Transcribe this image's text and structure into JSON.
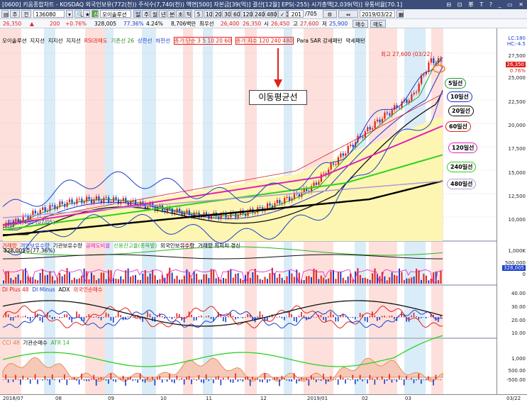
{
  "title": "[0600] 키움종합차트 - KOSDAQ 외국인보유(772(천)) 주식수(7,740(천)) 액면[500] 자본금[39(억)] 결산[12월] EPS(-255) 시가총액[2,039(억)] 유통비율[70.1]",
  "window_controls": "⊟ ⊡ 革 T ? _ ▭ ✕",
  "toolbar1": {
    "code": "136080",
    "name": "오이솔루션",
    "period_buttons": [
      "일",
      "주",
      "월",
      "년",
      "분",
      "초",
      "틱"
    ],
    "minute_buttons": [
      "5",
      "10",
      "20",
      "30",
      "60",
      "120",
      "240",
      "480",
      "120"
    ],
    "count": "201",
    "total": "/705",
    "date": "2019/03/22",
    "prefix_a": "주",
    "prefix_b": "전"
  },
  "toolbar2": {
    "price": "26,350",
    "arrow": "▲",
    "change": "200",
    "change_pct": "+0.76%",
    "volume": "328,005",
    "ratio1": "77.36%",
    "ratio2": "4.24%",
    "amount": "8,706백만",
    "p_low_label": "최우선",
    "p1": "26,400",
    "p2": "26,350",
    "open_label": "시",
    "open": "26,450",
    "high_label": "고",
    "high": "27,600",
    "low_label": "저",
    "low": "25,900",
    "buy": "매수",
    "sell": "매도"
  },
  "price_panel": {
    "legend": [
      "오이솔루션",
      "지지선",
      "지지선",
      "지지선",
      "RSI과매도",
      "기준선 26",
      "상한선",
      "하한선"
    ],
    "ma_legend": "종가 단순 3 5 10 20 60",
    "ma_legend2": "종가 지수 120 240 480",
    "legend_tail": [
      "Para SAR 강세패턴",
      "약세패턴"
    ],
    "high_note": "최고 27,600 (03/22)",
    "low_note": "최저 9,400 (07/05)",
    "big_label": "이동평균선",
    "right_top": [
      "LC:180",
      "HC:-4.5"
    ],
    "price_tag": "26,350",
    "pct_tag": "0.76%",
    "axis": [
      "27,500",
      "25,000",
      "22,500",
      "20,000",
      "17,500",
      "15,000",
      "12,500",
      "10,000"
    ],
    "ma_tags": [
      {
        "label": "5일선",
        "color": "#1e9a3a"
      },
      {
        "label": "10일선",
        "color": "#1a2fd0"
      },
      {
        "label": "20일선",
        "color": "#111111"
      },
      {
        "label": "60일선",
        "color": "#e0201a"
      },
      {
        "label": "120일선",
        "color": "#e020c0"
      },
      {
        "label": "240일선",
        "color": "#2fd020"
      },
      {
        "label": "480일선",
        "color": "#b09ad8"
      }
    ]
  },
  "volume_panel": {
    "legend": [
      "거래량",
      "개인보유수량",
      "기관보유수량",
      "공매도비율",
      "신용잔고율(종목별)",
      "외국인보유수량",
      "거래량 최저치 경신"
    ],
    "sub": "328,005주(77.36%)",
    "axis": [
      "1,000K",
      "500,000",
      "328,005",
      "0"
    ]
  },
  "dmi_panel": {
    "legend": [
      "DI Plus 48",
      "DI Minus",
      "ADX",
      "외국인순매수"
    ],
    "axis": [
      "40.00",
      "30.00",
      "20.00",
      "10.00"
    ]
  },
  "cci_panel": {
    "legend": [
      "CCI 48",
      "기관순매수",
      "ATR 14"
    ],
    "axis": [
      "1,000",
      "500.00",
      "-500.00"
    ]
  },
  "x_axis": [
    "2018/07",
    "08",
    "09",
    "10",
    "11",
    "12",
    "2019/01",
    "02",
    "03",
    "03/22"
  ],
  "colors": {
    "up": "#e0201a",
    "down": "#1a3fd0",
    "bg_pink": "#fde0dc",
    "bg_blue": "#d9ecf7",
    "fill": "#fdf6b2"
  }
}
